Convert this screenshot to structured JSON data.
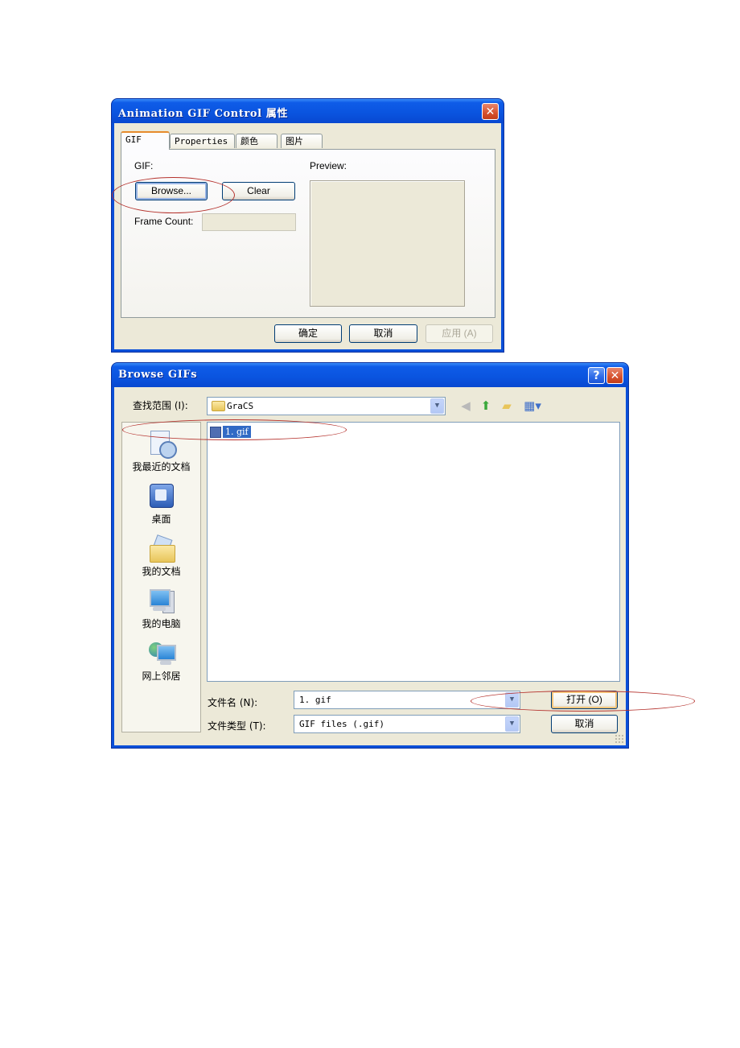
{
  "dialog_properties": {
    "title": "Animation GIF Control 属性",
    "close_label": "✕",
    "tabs": [
      {
        "label": "GIF",
        "active": true
      },
      {
        "label": "Properties",
        "active": false
      },
      {
        "label": "颜色",
        "active": false
      },
      {
        "label": "图片",
        "active": false
      }
    ],
    "gif_group_label": "GIF:",
    "browse_button": "Browse...",
    "clear_button": "Clear",
    "frame_count_label": "Frame Count:",
    "frame_count_value": "",
    "preview_label": "Preview:",
    "ok_button": "确定",
    "cancel_button": "取消",
    "apply_button": "应用 (A)"
  },
  "dialog_browse": {
    "title": "Browse GIFs",
    "help_label": "?",
    "close_label": "✕",
    "look_in_label": "查找范围 (I):",
    "look_in_value": "GraCS",
    "toolbar_icons": [
      "back-icon",
      "up-folder-icon",
      "new-folder-icon",
      "view-menu-icon"
    ],
    "places": [
      {
        "label": "我最近的文档",
        "icon": "recent-documents-icon"
      },
      {
        "label": "桌面",
        "icon": "desktop-icon"
      },
      {
        "label": "我的文档",
        "icon": "my-documents-icon"
      },
      {
        "label": "我的电脑",
        "icon": "my-computer-icon"
      },
      {
        "label": "网上邻居",
        "icon": "network-places-icon"
      }
    ],
    "files": [
      {
        "name": "1. gif",
        "selected": true
      }
    ],
    "filename_label": "文件名 (N):",
    "filename_value": "1. gif",
    "filetype_label": "文件类型 (T):",
    "filetype_value": "GIF files (.gif)",
    "open_button": "打开 (O)",
    "cancel_button": "取消"
  },
  "annotations": {
    "highlight_color": "#b5322d"
  }
}
